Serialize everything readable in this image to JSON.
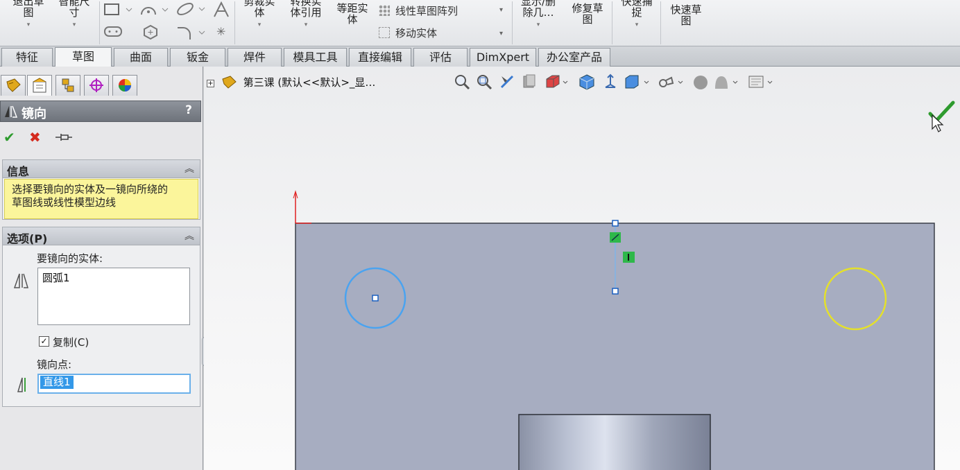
{
  "ribbon": {
    "exit_sketch": "退出草图",
    "smart_dimension": "智能尺寸",
    "trim": "剪裁实体",
    "convert": "转换实体引用",
    "offset": "等距实体",
    "linear_pattern": "线性草图阵列",
    "move_entities": "移动实体",
    "display_delete": "显示/删除几…",
    "repair": "修复草图",
    "quick_snaps": "快速捕捉",
    "rapid_sketch": "快速草图"
  },
  "tabs": [
    {
      "label": "特征",
      "active": false
    },
    {
      "label": "草图",
      "active": true
    },
    {
      "label": "曲面",
      "active": false
    },
    {
      "label": "钣金",
      "active": false
    },
    {
      "label": "焊件",
      "active": false
    },
    {
      "label": "模具工具",
      "active": false
    },
    {
      "label": "直接编辑",
      "active": false
    },
    {
      "label": "评估",
      "active": false
    },
    {
      "label": "DimXpert",
      "active": false
    },
    {
      "label": "办公室产品",
      "active": false
    }
  ],
  "property_manager": {
    "title": "镜向",
    "help": "?",
    "info": {
      "header": "信息",
      "message_line1": "选择要镜向的实体及一镜向所绕的",
      "message_line2": "草图线或线性模型边线"
    },
    "options": {
      "header": "选项(P)",
      "entities_label": "要镜向的实体:",
      "entities": [
        "圆弧1"
      ],
      "copy_label": "复制(C)",
      "copy_checked": true,
      "mirror_about_label": "镜向点:",
      "mirror_about_value": "直线1"
    }
  },
  "viewport": {
    "tree_label": "第三课  (默认<<默认>_显…"
  },
  "colors": {
    "part_face": "#a7adc1",
    "selected_circle": "#4aa3f0",
    "preview_circle": "#e4e02b",
    "info_bg": "#fbf59b",
    "confirm": "#2e9b2e"
  }
}
